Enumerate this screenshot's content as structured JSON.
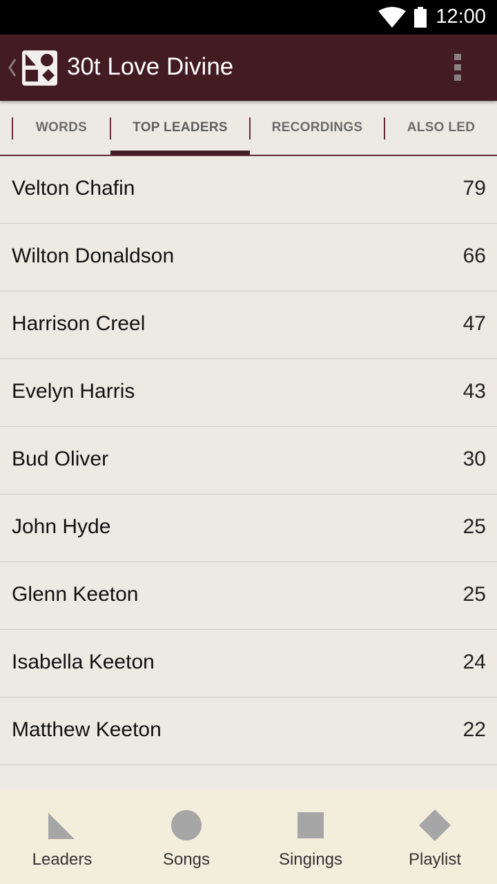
{
  "status_bar": {
    "time": "12:00",
    "icons": [
      "wifi-icon",
      "battery-icon"
    ]
  },
  "app_bar": {
    "title": "30t Love Divine",
    "icons": [
      "back-chevron-icon",
      "app-logo-icon",
      "overflow-menu-icon"
    ],
    "color": "#421b23"
  },
  "tabs": [
    {
      "label": "WORDS",
      "active": false
    },
    {
      "label": "TOP LEADERS",
      "active": true
    },
    {
      "label": "RECORDINGS",
      "active": false
    },
    {
      "label": "ALSO LED",
      "active": false
    }
  ],
  "leaders": [
    {
      "name": "Velton Chafin",
      "count": "79"
    },
    {
      "name": "Wilton Donaldson",
      "count": "66"
    },
    {
      "name": "Harrison Creel",
      "count": "47"
    },
    {
      "name": "Evelyn Harris",
      "count": "43"
    },
    {
      "name": "Bud Oliver",
      "count": "30"
    },
    {
      "name": "John Hyde",
      "count": "25"
    },
    {
      "name": "Glenn Keeton",
      "count": "25"
    },
    {
      "name": "Isabella Keeton",
      "count": "24"
    },
    {
      "name": "Matthew Keeton",
      "count": "22"
    }
  ],
  "bottom_nav": [
    {
      "label": "Leaders",
      "icon": "triangle-icon"
    },
    {
      "label": "Songs",
      "icon": "circle-icon"
    },
    {
      "label": "Singings",
      "icon": "square-icon"
    },
    {
      "label": "Playlist",
      "icon": "diamond-icon"
    }
  ]
}
